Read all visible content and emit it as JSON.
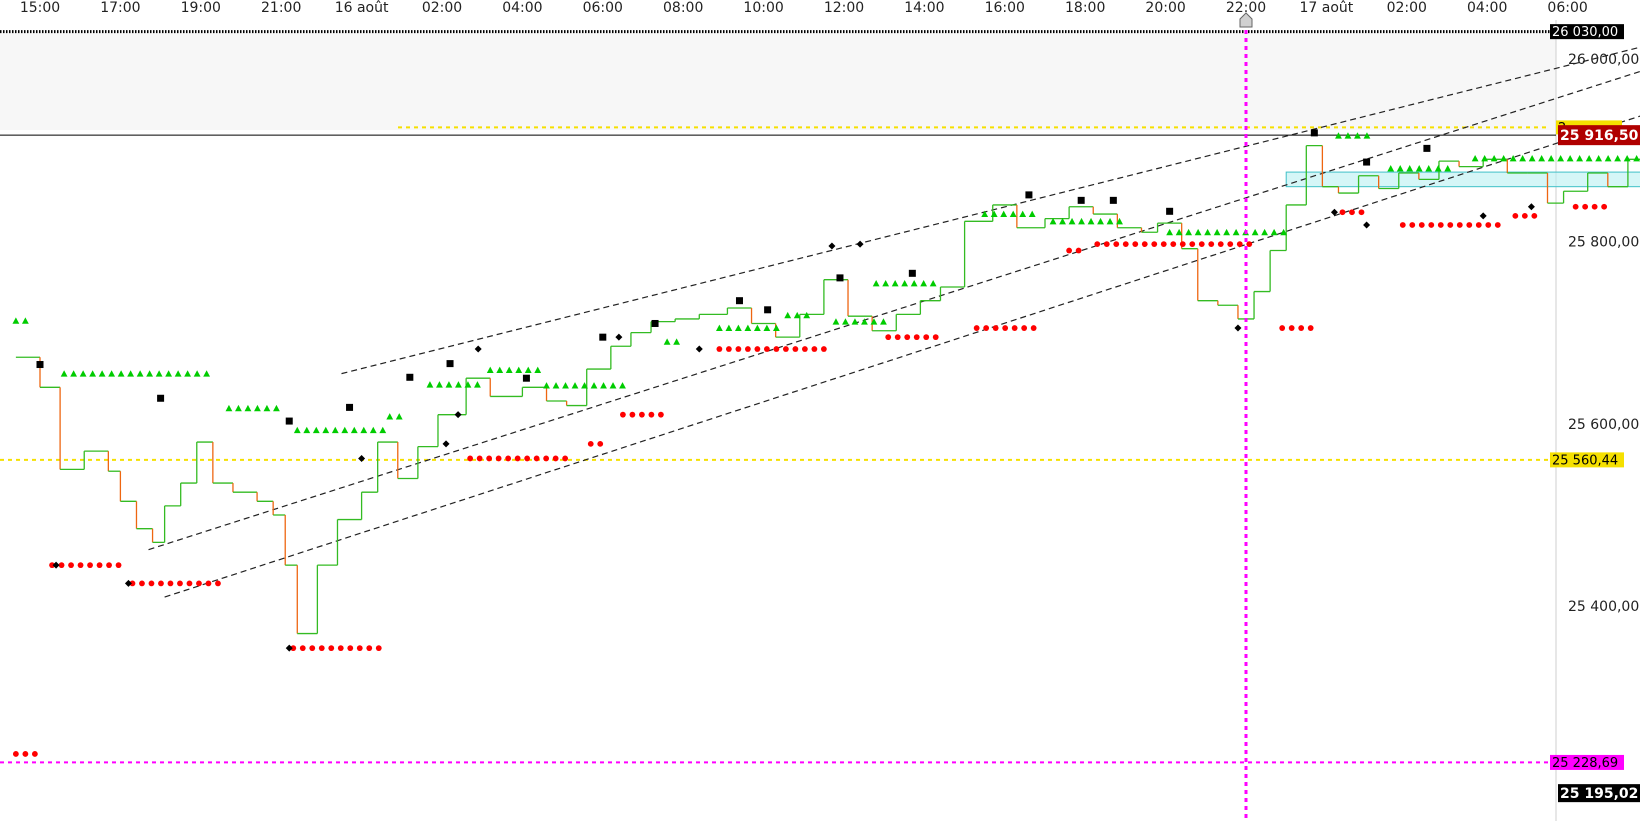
{
  "chart_data": {
    "type": "line",
    "title": "",
    "x_labels": [
      "15:00",
      "17:00",
      "19:00",
      "21:00",
      "16 août",
      "02:00",
      "04:00",
      "06:00",
      "08:00",
      "10:00",
      "12:00",
      "14:00",
      "16:00",
      "18:00",
      "20:00",
      "22:00",
      "17 août",
      "02:00",
      "04:00",
      "06:00"
    ],
    "y_ticks": [
      "26 000,00",
      "25 800,00",
      "25 600,00",
      "25 400,00"
    ],
    "y_tick_values": [
      26000,
      25800,
      25600,
      25400
    ],
    "ylim": [
      25186,
      26057
    ],
    "grid": false,
    "price_tags": {
      "top": "26 030,00",
      "current": "25 916,50",
      "hidden_yellow": "2",
      "yellow_level": "25 560,44",
      "magenta_level": "25 228,69",
      "bottom": "25 195,02"
    },
    "horizontal_levels": [
      {
        "name": "top-dotted",
        "value": 26030,
        "color": "#000000"
      },
      {
        "name": "yellow-upper",
        "value": 25925,
        "color": "#f5e000"
      },
      {
        "name": "current-price",
        "value": 25916.5,
        "color": "#000000"
      },
      {
        "name": "yellow-lower",
        "value": 25560.44,
        "color": "#f5e000"
      },
      {
        "name": "magenta",
        "value": 25228.69,
        "color": "#ff00ff"
      }
    ],
    "vertical_marker_time_index": 15,
    "price_series": [
      {
        "t": -0.3,
        "v": 25673
      },
      {
        "t": 0.0,
        "v": 25640
      },
      {
        "t": 0.25,
        "v": 25550
      },
      {
        "t": 0.55,
        "v": 25570
      },
      {
        "t": 0.85,
        "v": 25548
      },
      {
        "t": 1.0,
        "v": 25515
      },
      {
        "t": 1.2,
        "v": 25485
      },
      {
        "t": 1.4,
        "v": 25470
      },
      {
        "t": 1.55,
        "v": 25510
      },
      {
        "t": 1.75,
        "v": 25535
      },
      {
        "t": 1.95,
        "v": 25580
      },
      {
        "t": 2.15,
        "v": 25535
      },
      {
        "t": 2.4,
        "v": 25525
      },
      {
        "t": 2.7,
        "v": 25515
      },
      {
        "t": 2.9,
        "v": 25500
      },
      {
        "t": 3.05,
        "v": 25445
      },
      {
        "t": 3.2,
        "v": 25370
      },
      {
        "t": 3.45,
        "v": 25445
      },
      {
        "t": 3.7,
        "v": 25495
      },
      {
        "t": 4.0,
        "v": 25525
      },
      {
        "t": 4.2,
        "v": 25580
      },
      {
        "t": 4.45,
        "v": 25540
      },
      {
        "t": 4.7,
        "v": 25575
      },
      {
        "t": 4.95,
        "v": 25610
      },
      {
        "t": 5.3,
        "v": 25650
      },
      {
        "t": 5.6,
        "v": 25630
      },
      {
        "t": 6.0,
        "v": 25640
      },
      {
        "t": 6.3,
        "v": 25625
      },
      {
        "t": 6.55,
        "v": 25620
      },
      {
        "t": 6.8,
        "v": 25660
      },
      {
        "t": 7.1,
        "v": 25685
      },
      {
        "t": 7.35,
        "v": 25700
      },
      {
        "t": 7.6,
        "v": 25712
      },
      {
        "t": 7.9,
        "v": 25715
      },
      {
        "t": 8.2,
        "v": 25720
      },
      {
        "t": 8.55,
        "v": 25727
      },
      {
        "t": 8.85,
        "v": 25710
      },
      {
        "t": 9.15,
        "v": 25695
      },
      {
        "t": 9.45,
        "v": 25720
      },
      {
        "t": 9.75,
        "v": 25758
      },
      {
        "t": 10.05,
        "v": 25718
      },
      {
        "t": 10.35,
        "v": 25702
      },
      {
        "t": 10.65,
        "v": 25720
      },
      {
        "t": 10.95,
        "v": 25735
      },
      {
        "t": 11.2,
        "v": 25750
      },
      {
        "t": 11.5,
        "v": 25822
      },
      {
        "t": 11.85,
        "v": 25840
      },
      {
        "t": 12.15,
        "v": 25815
      },
      {
        "t": 12.5,
        "v": 25825
      },
      {
        "t": 12.8,
        "v": 25838
      },
      {
        "t": 13.1,
        "v": 25830
      },
      {
        "t": 13.4,
        "v": 25815
      },
      {
        "t": 13.7,
        "v": 25810
      },
      {
        "t": 13.9,
        "v": 25820
      },
      {
        "t": 14.2,
        "v": 25792
      },
      {
        "t": 14.4,
        "v": 25735
      },
      {
        "t": 14.65,
        "v": 25730
      },
      {
        "t": 14.9,
        "v": 25715
      },
      {
        "t": 15.1,
        "v": 25745
      },
      {
        "t": 15.3,
        "v": 25790
      },
      {
        "t": 15.5,
        "v": 25840
      },
      {
        "t": 15.75,
        "v": 25905
      },
      {
        "t": 15.95,
        "v": 25860
      },
      {
        "t": 16.15,
        "v": 25853
      },
      {
        "t": 16.4,
        "v": 25872
      },
      {
        "t": 16.65,
        "v": 25858
      },
      {
        "t": 16.9,
        "v": 25875
      },
      {
        "t": 17.15,
        "v": 25868
      },
      {
        "t": 17.4,
        "v": 25888
      },
      {
        "t": 17.65,
        "v": 25882
      },
      {
        "t": 17.95,
        "v": 25890
      },
      {
        "t": 18.25,
        "v": 25875
      },
      {
        "t": 18.5,
        "v": 25875
      },
      {
        "t": 18.75,
        "v": 25842
      },
      {
        "t": 18.95,
        "v": 25855
      },
      {
        "t": 19.25,
        "v": 25875
      },
      {
        "t": 19.5,
        "v": 25860
      },
      {
        "t": 19.75,
        "v": 25890
      },
      {
        "t": 20.0,
        "v": 25895
      },
      {
        "t": 20.15,
        "v": 25918
      },
      {
        "t": 20.35,
        "v": 25905
      }
    ],
    "channel_lines": [
      {
        "name": "upper",
        "t1": 3.75,
        "v1": 25655,
        "t2": 21.8,
        "v2": 26055
      },
      {
        "name": "middle",
        "t1": 1.35,
        "v1": 25462,
        "t2": 21.8,
        "v2": 26040
      },
      {
        "name": "lower",
        "t1": 1.55,
        "v1": 25410,
        "t2": 21.8,
        "v2": 25992
      }
    ],
    "rectangle": {
      "t1": 15.5,
      "t2": 20.5,
      "v1": 25860,
      "v2": 25876
    },
    "green_triangle_runs": [
      {
        "t1": -0.3,
        "t2": -0.1,
        "v": 25713
      },
      {
        "t1": 0.3,
        "t2": 2.1,
        "v": 25655
      },
      {
        "t1": 2.35,
        "t2": 3.0,
        "v": 25617
      },
      {
        "t1": 3.2,
        "t2": 4.3,
        "v": 25593
      },
      {
        "t1": 4.35,
        "t2": 4.55,
        "v": 25608
      },
      {
        "t1": 4.85,
        "t2": 5.45,
        "v": 25643
      },
      {
        "t1": 5.6,
        "t2": 6.2,
        "v": 25659
      },
      {
        "t1": 6.3,
        "t2": 7.35,
        "v": 25642
      },
      {
        "t1": 7.8,
        "t2": 8.0,
        "v": 25690
      },
      {
        "t1": 8.45,
        "t2": 9.2,
        "v": 25705
      },
      {
        "t1": 9.3,
        "t2": 9.6,
        "v": 25719
      },
      {
        "t1": 9.9,
        "t2": 10.55,
        "v": 25712
      },
      {
        "t1": 10.4,
        "t2": 11.2,
        "v": 25754
      },
      {
        "t1": 11.75,
        "t2": 12.45,
        "v": 25830
      },
      {
        "t1": 12.6,
        "t2": 13.45,
        "v": 25822
      },
      {
        "t1": 14.05,
        "t2": 15.5,
        "v": 25810
      },
      {
        "t1": 16.15,
        "t2": 16.55,
        "v": 25916
      },
      {
        "t1": 16.8,
        "t2": 17.55,
        "v": 25880
      },
      {
        "t1": 17.85,
        "t2": 20.4,
        "v": 25891
      }
    ],
    "red_dot_runs": [
      {
        "t1": -0.3,
        "t2": 0.0,
        "v": 25238
      },
      {
        "t1": 0.15,
        "t2": 1.0,
        "v": 25445
      },
      {
        "t1": 1.15,
        "t2": 2.3,
        "v": 25425
      },
      {
        "t1": 3.15,
        "t2": 4.3,
        "v": 25354
      },
      {
        "t1": 5.35,
        "t2": 6.6,
        "v": 25562
      },
      {
        "t1": 6.85,
        "t2": 7.0,
        "v": 25578
      },
      {
        "t1": 7.25,
        "t2": 7.75,
        "v": 25610
      },
      {
        "t1": 8.45,
        "t2": 9.75,
        "v": 25682
      },
      {
        "t1": 10.55,
        "t2": 11.15,
        "v": 25695
      },
      {
        "t1": 11.65,
        "t2": 12.4,
        "v": 25705
      },
      {
        "t1": 12.8,
        "t2": 13.0,
        "v": 25790
      },
      {
        "t1": 13.15,
        "t2": 15.05,
        "v": 25797
      },
      {
        "t1": 15.45,
        "t2": 15.8,
        "v": 25705
      },
      {
        "t1": 16.2,
        "t2": 16.45,
        "v": 25832
      },
      {
        "t1": 16.95,
        "t2": 18.15,
        "v": 25818
      },
      {
        "t1": 18.35,
        "t2": 18.65,
        "v": 25828
      },
      {
        "t1": 19.1,
        "t2": 19.5,
        "v": 25838
      }
    ],
    "black_square_markers": [
      {
        "t": 0.0,
        "v": 25665
      },
      {
        "t": 1.5,
        "v": 25628
      },
      {
        "t": 3.1,
        "v": 25603
      },
      {
        "t": 3.85,
        "v": 25618
      },
      {
        "t": 4.6,
        "v": 25651
      },
      {
        "t": 5.1,
        "v": 25666
      },
      {
        "t": 6.05,
        "v": 25650
      },
      {
        "t": 7.0,
        "v": 25695
      },
      {
        "t": 7.65,
        "v": 25710
      },
      {
        "t": 8.7,
        "v": 25735
      },
      {
        "t": 9.05,
        "v": 25725
      },
      {
        "t": 9.95,
        "v": 25760
      },
      {
        "t": 10.85,
        "v": 25765
      },
      {
        "t": 12.3,
        "v": 25851
      },
      {
        "t": 12.95,
        "v": 25845
      },
      {
        "t": 13.35,
        "v": 25845
      },
      {
        "t": 14.05,
        "v": 25833
      },
      {
        "t": 15.85,
        "v": 25919
      },
      {
        "t": 16.5,
        "v": 25887
      },
      {
        "t": 17.25,
        "v": 25902
      }
    ],
    "black_diamond_markers": [
      {
        "t": 0.2,
        "v": 25445
      },
      {
        "t": 1.1,
        "v": 25425
      },
      {
        "t": 3.1,
        "v": 25354
      },
      {
        "t": 4.0,
        "v": 25562
      },
      {
        "t": 5.05,
        "v": 25578
      },
      {
        "t": 5.2,
        "v": 25610
      },
      {
        "t": 5.45,
        "v": 25682
      },
      {
        "t": 7.2,
        "v": 25695
      },
      {
        "t": 8.2,
        "v": 25682
      },
      {
        "t": 9.85,
        "v": 25795
      },
      {
        "t": 10.2,
        "v": 25797
      },
      {
        "t": 14.9,
        "v": 25705
      },
      {
        "t": 16.1,
        "v": 25832
      },
      {
        "t": 16.5,
        "v": 25818
      },
      {
        "t": 17.95,
        "v": 25828
      },
      {
        "t": 18.55,
        "v": 25838
      }
    ],
    "colors": {
      "rising": "#33bb22",
      "falling": "#ee6611",
      "triangle": "#00cc00",
      "dot": "#ff0000",
      "channel": "#222222",
      "yellow": "#f5e000",
      "magenta": "#ff00ff",
      "current_tag": "#b00000",
      "rect_fill": "#b9f0f2",
      "rect_stroke": "#40c0c8"
    }
  }
}
